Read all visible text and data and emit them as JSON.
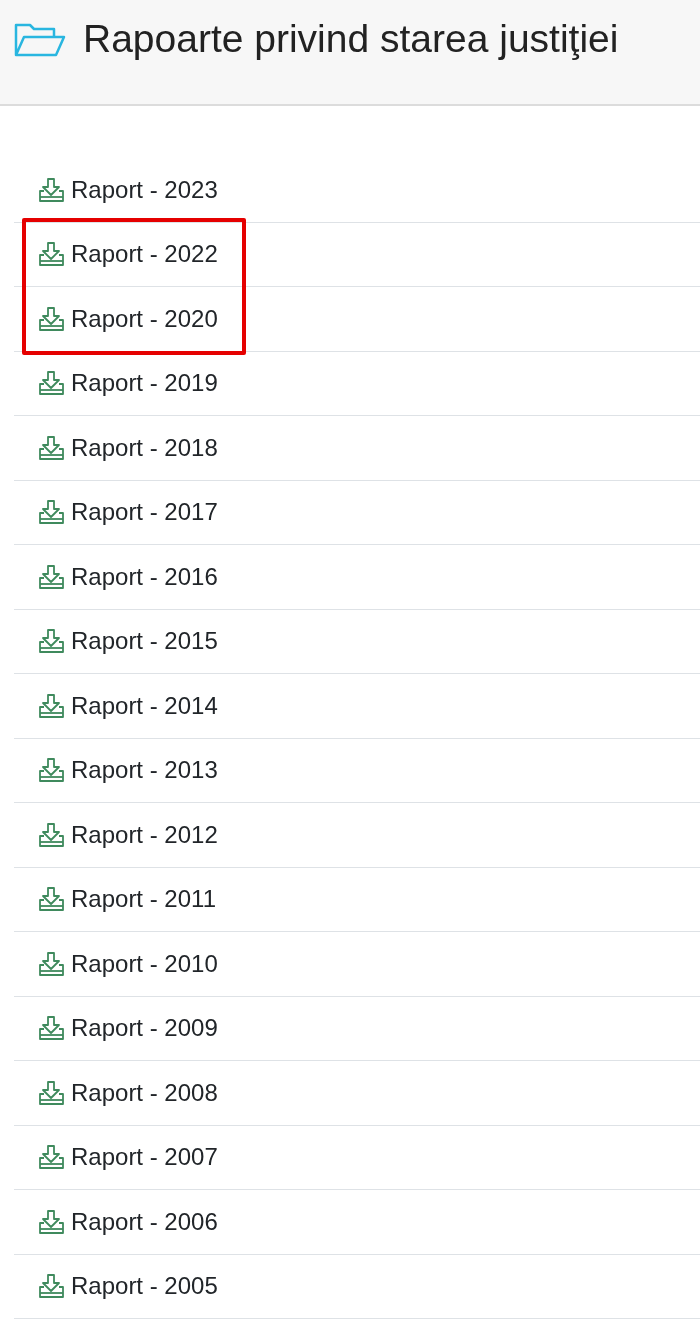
{
  "header": {
    "title": "Rapoarte privind starea justiţiei"
  },
  "reports": [
    {
      "kind": "link",
      "label": "Raport - 2023"
    },
    {
      "kind": "highlighted_group",
      "items": [
        {
          "label": "Raport - 2022"
        },
        {
          "label": "Raport - 2020"
        }
      ]
    },
    {
      "kind": "link",
      "label": "Raport - 2019"
    },
    {
      "kind": "link",
      "label": "Raport - 2018"
    },
    {
      "kind": "link",
      "label": "Raport - 2017"
    },
    {
      "kind": "link",
      "label": "Raport - 2016"
    },
    {
      "kind": "link",
      "label": "Raport - 2015"
    },
    {
      "kind": "link",
      "label": "Raport - 2014"
    },
    {
      "kind": "link",
      "label": "Raport - 2013"
    },
    {
      "kind": "link",
      "label": "Raport - 2012"
    },
    {
      "kind": "link",
      "label": "Raport - 2011"
    },
    {
      "kind": "link",
      "label": "Raport - 2010"
    },
    {
      "kind": "link",
      "label": "Raport - 2009"
    },
    {
      "kind": "link",
      "label": "Raport - 2008"
    },
    {
      "kind": "link",
      "label": "Raport - 2007"
    },
    {
      "kind": "link",
      "label": "Raport - 2006"
    },
    {
      "kind": "link",
      "label": "Raport - 2005"
    }
  ]
}
